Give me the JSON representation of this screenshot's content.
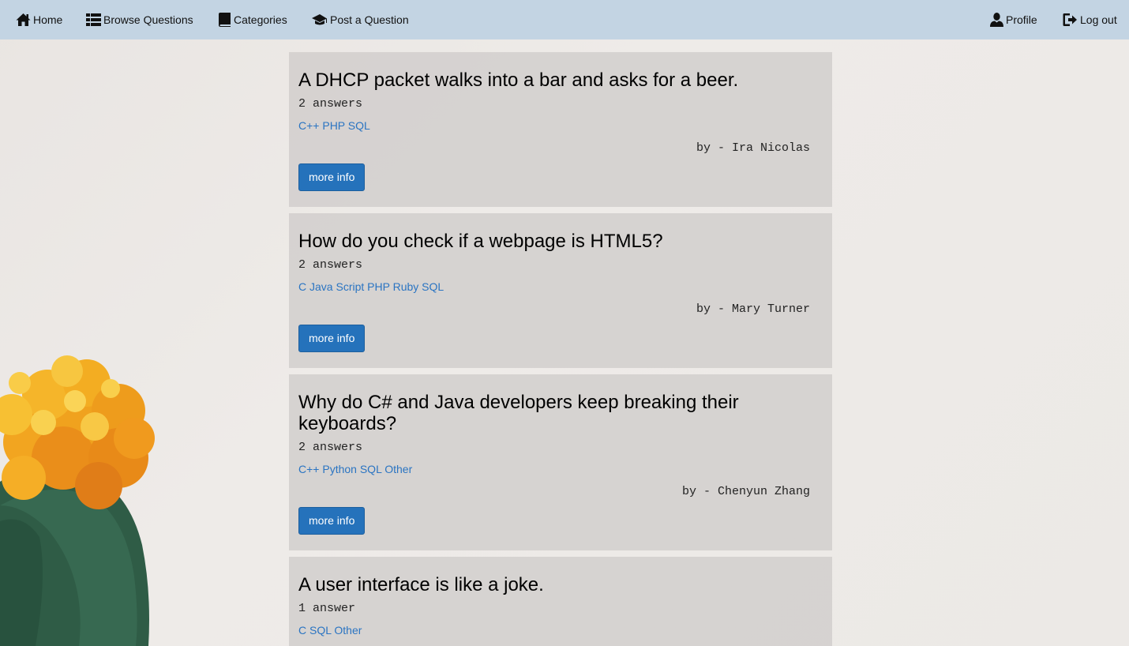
{
  "nav": {
    "home": "Home",
    "browse": "Browse Questions",
    "categories": "Categories",
    "post": "Post a Question",
    "profile": "Profile",
    "logout": "Log out"
  },
  "questions": [
    {
      "title": "A DHCP packet walks into a bar and asks for a beer.",
      "answers": "2 answers",
      "tags": [
        "C++",
        "PHP",
        "SQL"
      ],
      "author": "by - Ira Nicolas",
      "button": "more info"
    },
    {
      "title": "How do you check if a webpage is HTML5?",
      "answers": "2 answers",
      "tags": [
        "C",
        "Java Script",
        "PHP",
        "Ruby",
        "SQL"
      ],
      "author": "by - Mary Turner",
      "button": "more info"
    },
    {
      "title": "Why do C# and Java developers keep breaking their keyboards?",
      "answers": "2 answers",
      "tags": [
        "C++",
        "Python",
        "SQL",
        "Other"
      ],
      "author": "by - Chenyun Zhang",
      "button": "more info"
    },
    {
      "title": "A user interface is like a joke.",
      "answers": "1 answer",
      "tags": [
        "C",
        "SQL",
        "Other"
      ],
      "author": "",
      "button": ""
    }
  ],
  "colors": {
    "navbar": "#c3d4e3",
    "link": "#2a74c2",
    "button": "#2572bb"
  },
  "icons": {
    "home": "home-icon",
    "browse": "list-icon",
    "categories": "book-icon",
    "post": "graduation-cap-icon",
    "profile": "user-icon",
    "logout": "logout-icon"
  }
}
